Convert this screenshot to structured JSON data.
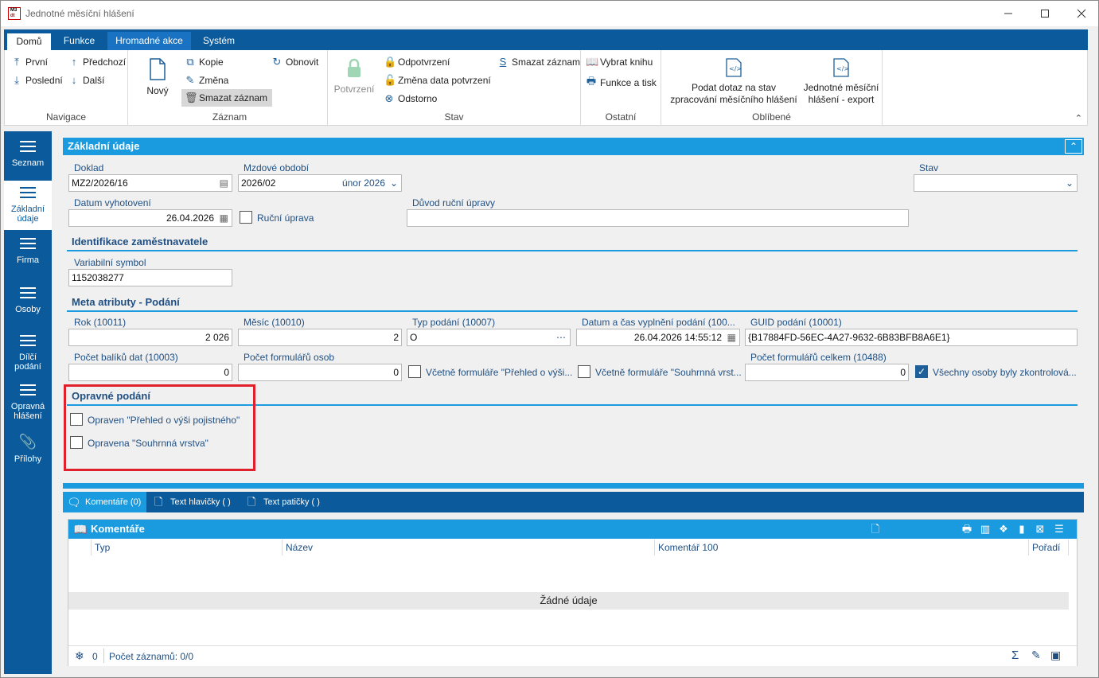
{
  "window": {
    "title": "Jednotné měsíční hlášení",
    "app_icon_text_top": "M3",
    "app_icon_text_bottom": "dt"
  },
  "ribbon_tabs": [
    "Domů",
    "Funkce",
    "Hromadné akce",
    "Systém"
  ],
  "ribbon": {
    "navigace": {
      "label": "Navigace",
      "prvni": "První",
      "predchozi": "Předchozí",
      "posledni": "Poslední",
      "dalsi": "Další"
    },
    "zaznam": {
      "label": "Záznam",
      "novy": "Nový",
      "kopie": "Kopie",
      "obnovit": "Obnovit",
      "zmena": "Změna",
      "smazat": "Smazat záznam"
    },
    "stav": {
      "label": "Stav",
      "potvrzeni": "Potvrzení",
      "odpotvrzeni": "Odpotvrzení",
      "zmena_data": "Změna data potvrzení",
      "odstorno": "Odstorno",
      "smazat": "Smazat záznam"
    },
    "ostatni": {
      "label": "Ostatní",
      "vybrat_knihu": "Vybrat knihu",
      "funkce_tisk": "Funkce a tisk"
    },
    "oblibene": {
      "label": "Oblíbené",
      "podat_1": "Podat dotaz na stav",
      "podat_2": "zpracování měsíčního hlášení",
      "export_1": "Jednotné měsíční",
      "export_2": "hlášení - export"
    }
  },
  "nav": [
    {
      "label": "Seznam"
    },
    {
      "label1": "Základní",
      "label2": "údaje"
    },
    {
      "label": "Firma"
    },
    {
      "label": "Osoby"
    },
    {
      "label1": "Dílčí",
      "label2": "podání"
    },
    {
      "label1": "Opravná",
      "label2": "hlášení"
    },
    {
      "label": "Přílohy"
    }
  ],
  "form": {
    "header": "Základní údaje",
    "doklad": {
      "label": "Doklad",
      "value": "MZ2/2026/16"
    },
    "mzdove_obdobi": {
      "label": "Mzdové období",
      "value": "2026/02",
      "hint": "únor 2026"
    },
    "stav": {
      "label": "Stav",
      "value": ""
    },
    "datum_vyhotoveni": {
      "label": "Datum vyhotovení",
      "value": "26.04.2026"
    },
    "rucni_uprava": {
      "label": "Ruční úprava"
    },
    "duvod": {
      "label": "Důvod ruční úpravy",
      "value": ""
    },
    "identifikace": {
      "title": "Identifikace zaměstnavatele",
      "vs_label": "Variabilní symbol",
      "vs_value": "1152038277"
    },
    "meta": {
      "title": "Meta atributy - Podání",
      "rok": {
        "label": "Rok (10011)",
        "value": "2 026"
      },
      "mesic": {
        "label": "Měsíc (10010)",
        "value": "2"
      },
      "typ": {
        "label": "Typ podání (10007)",
        "value": "O"
      },
      "datum_cas": {
        "label": "Datum a čas vyplnění podání (100...",
        "value": "26.04.2026 14:55:12"
      },
      "guid": {
        "label": "GUID podání (10001)",
        "value": "{B17884FD-56EC-4A27-9632-6B83BFB8A6E1}"
      },
      "pocet_baliku": {
        "label": "Počet balíků dat (10003)",
        "value": "0"
      },
      "pocet_form_osob": {
        "label": "Počet formulářů osob",
        "value": "0"
      },
      "vcetne_prehled": "Včetně formuláře \"Přehled o výši...",
      "vcetne_souhrnna": "Včetně formuláře \"Souhrnná vrst...",
      "pocet_celkem": {
        "label": "Počet formulářů celkem (10488)",
        "value": "0"
      },
      "vsechny_osoby": "Všechny osoby byly zkontrolová..."
    },
    "opravne": {
      "title": "Opravné podání",
      "opraven_prehled": "Opraven \"Přehled o výši pojistného\"",
      "opravena_souhrnna": "Opravena \"Souhrnná vrstva\""
    }
  },
  "bottom_tabs": [
    "Komentáře (0)",
    "Text hlavičky ( )",
    "Text patičky ( )"
  ],
  "grid": {
    "title": "Komentáře",
    "columns": [
      "Typ",
      "Název",
      "Komentář 100",
      "Pořadí"
    ],
    "empty": "Žádné údaje",
    "footer_count": "0",
    "footer_records": "Počet záznamů: 0/0"
  },
  "colors": {
    "ribbon_blue": "#0a5a9c",
    "panel_blue": "#1a9be0",
    "highlight_red": "#e0202a"
  }
}
